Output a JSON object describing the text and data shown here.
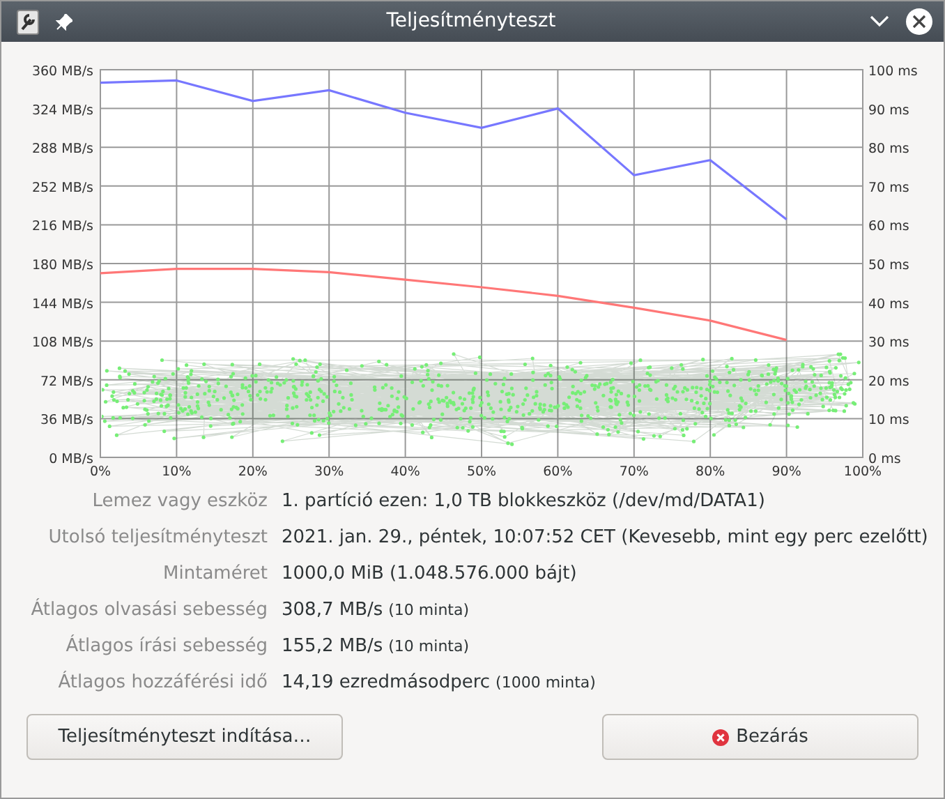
{
  "window": {
    "title": "Teljesítményteszt"
  },
  "chart": {
    "chart_data": {
      "type": "line",
      "categories": [
        "0%",
        "10%",
        "20%",
        "30%",
        "40%",
        "50%",
        "60%",
        "70%",
        "80%",
        "90%",
        "100%"
      ],
      "ylim": [
        0,
        360
      ],
      "grid": true,
      "yticks": [
        {
          "value": 0,
          "label": "0 MB/s"
        },
        {
          "value": 36,
          "label": "36 MB/s"
        },
        {
          "value": 72,
          "label": "72 MB/s"
        },
        {
          "value": 108,
          "label": "108 MB/s"
        },
        {
          "value": 144,
          "label": "144 MB/s"
        },
        {
          "value": 180,
          "label": "180 MB/s"
        },
        {
          "value": 216,
          "label": "216 MB/s"
        },
        {
          "value": 252,
          "label": "252 MB/s"
        },
        {
          "value": 288,
          "label": "288 MB/s"
        },
        {
          "value": 324,
          "label": "324 MB/s"
        },
        {
          "value": 360,
          "label": "360 MB/s"
        }
      ],
      "series": [
        {
          "color": "#7777ff",
          "values": [
            348,
            350,
            331,
            341,
            320,
            306,
            324,
            262,
            276,
            221,
            null
          ]
        },
        {
          "color": "#ff7777",
          "values": [
            171,
            175,
            175,
            172,
            165,
            158,
            150,
            139,
            127,
            109,
            null
          ]
        }
      ]
    },
    "right_axis_labels": [
      "100 ms",
      "90 ms",
      "80 ms",
      "70 ms",
      "60 ms",
      "50 ms",
      "40 ms",
      "30 ms",
      "20 ms",
      "10 ms",
      "0 ms"
    ]
  },
  "info": [
    {
      "label": "Lemez vagy eszköz",
      "value": "1. partíció ezen: 1,0 TB blokkeszköz (/dev/md/DATA1)"
    },
    {
      "label": "Utolsó teljesítményteszt",
      "value": "2021. jan. 29., péntek, 10:07:52 CET (Kevesebb, mint egy perc ezelőtt)"
    },
    {
      "label": "Mintaméret",
      "value": "1000,0 MiB (1.048.576.000 bájt)"
    },
    {
      "label": "Átlagos olvasási sebesség",
      "value": "308,7 MB/s",
      "note": "(10 minta)"
    },
    {
      "label": "Átlagos írási sebesség",
      "value": "155,2 MB/s",
      "note": "(10 minta)"
    },
    {
      "label": "Átlagos hozzáférési idő",
      "value": "14,19 ezredmásodperc",
      "note": "(1000 minta)"
    }
  ],
  "buttons": {
    "start": "Teljesítményteszt indítása…",
    "close": "Bezárás"
  }
}
